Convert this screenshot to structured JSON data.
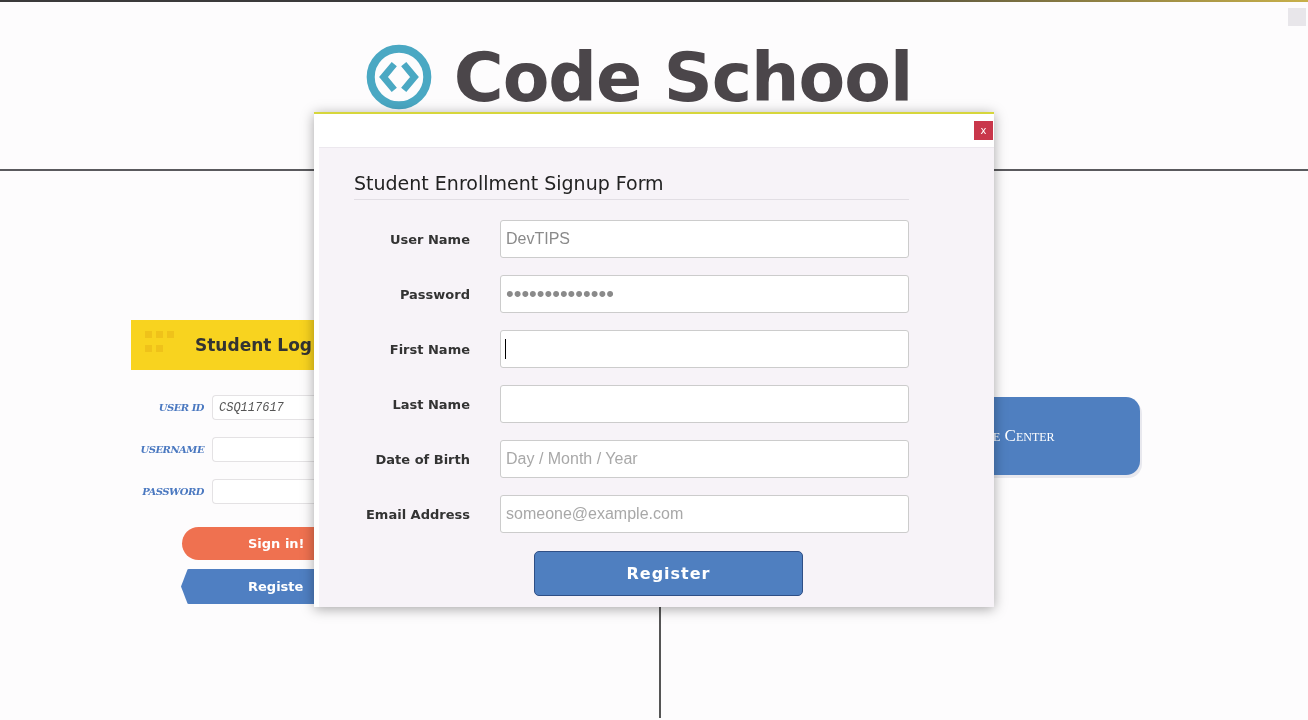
{
  "logo": {
    "text": "Code School"
  },
  "login_card": {
    "title": "Student Log",
    "fields": [
      {
        "label": "USER ID",
        "value": "CSQ117617"
      },
      {
        "label": "USERNAME"
      },
      {
        "label": "PASSWORD"
      }
    ],
    "buttons": [
      {
        "label": "Sign in!",
        "kind": "primary"
      },
      {
        "label": "Registe",
        "kind": "secondary"
      }
    ]
  },
  "center_button": {
    "label": "e Center"
  },
  "modal": {
    "close": "x",
    "title": "Student Enrollment Signup Form",
    "fields": [
      {
        "label": "User Name",
        "value": "DevTIPS"
      },
      {
        "label": "Password",
        "value": "••••••••••••••"
      },
      {
        "label": "First Name",
        "focused": true
      },
      {
        "label": "Last Name"
      },
      {
        "label": "Date of Birth",
        "placeholder": "Day / Month / Year"
      },
      {
        "label": "Email Address",
        "placeholder": "someone@example.com"
      }
    ],
    "submit": "Register"
  }
}
